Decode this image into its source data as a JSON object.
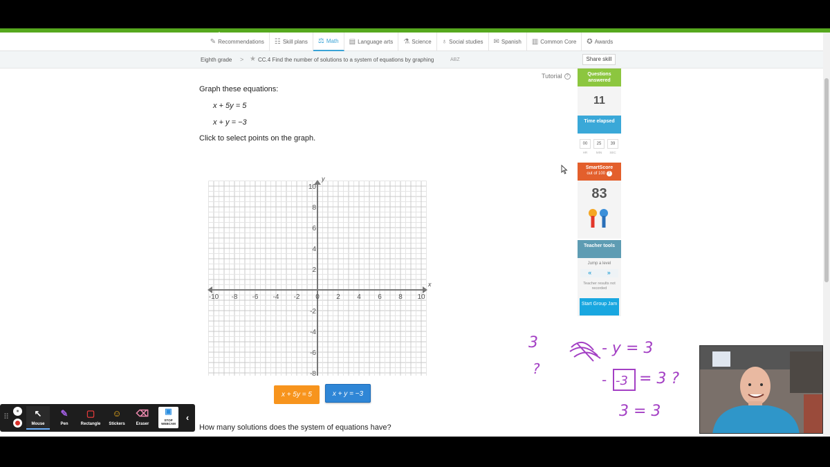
{
  "nav": {
    "items": [
      {
        "icon": "recommendations-icon",
        "glyph": "✎",
        "label": "Recommendations"
      },
      {
        "icon": "skill-plans-icon",
        "glyph": "☷",
        "label": "Skill plans"
      },
      {
        "icon": "math-icon",
        "glyph": "⚖",
        "label": "Math",
        "active": true
      },
      {
        "icon": "language-arts-icon",
        "glyph": "▤",
        "label": "Language arts"
      },
      {
        "icon": "science-icon",
        "glyph": "⚗",
        "label": "Science"
      },
      {
        "icon": "social-studies-icon",
        "glyph": "♁",
        "label": "Social studies"
      },
      {
        "icon": "spanish-icon",
        "glyph": "✉",
        "label": "Spanish"
      },
      {
        "icon": "common-core-icon",
        "glyph": "▥",
        "label": "Common Core"
      },
      {
        "icon": "awards-icon",
        "glyph": "✪",
        "label": "Awards"
      }
    ],
    "accent": "#3aa3d6"
  },
  "breadcrumb": {
    "grade": "Eighth grade",
    "separator": ">",
    "skill": "CC.4 Find the number of solutions to a system of equations by graphing",
    "code": "ABZ",
    "share_label": "Share skill"
  },
  "tutorial": {
    "label": "Tutorial",
    "icon_glyph": "?"
  },
  "problem": {
    "prompt": "Graph these equations:",
    "equations": [
      "x + 5y = 5",
      "x + y = −3"
    ],
    "instruction": "Click to select points on the graph.",
    "question": "How many solutions does the system of equations have?"
  },
  "graph": {
    "x_label": "x",
    "y_label": "y",
    "x_min": -10,
    "x_max": 10,
    "y_min": -10,
    "y_max": 10,
    "x_ticks": [
      "-10",
      "-8",
      "-6",
      "-4",
      "-2",
      "0",
      "2",
      "4",
      "6",
      "8",
      "10"
    ],
    "y_ticks": [
      "10",
      "8",
      "6",
      "4",
      "2",
      "-2",
      "-4",
      "-6",
      "-8",
      "-10"
    ],
    "grid": true
  },
  "equation_buttons": [
    {
      "label": "x + 5y = 5",
      "color": "#f7941d"
    },
    {
      "label": "x + y = −3",
      "color": "#2f86d6",
      "selected": true
    }
  ],
  "sidebar": {
    "questions_answered_label": "Questions answered",
    "questions_answered": "11",
    "time_elapsed_label": "Time elapsed",
    "time": {
      "hr": "00",
      "min": "25",
      "sec": "39"
    },
    "time_units": {
      "hr": "HR",
      "min": "MIN",
      "sec": "SEC"
    },
    "smartscore_label": "SmartScore",
    "smartscore_sub": "out of 100",
    "smartscore_help": "?",
    "smartscore": "83",
    "teacher_tools_label": "Teacher tools",
    "jump_label": "Jump a level",
    "jump_back": "«",
    "jump_forward": "»",
    "results_note": "Teacher results not recorded",
    "group_jam_label": "Start Group Jam",
    "colors": {
      "questions": "#8cc63f",
      "time": "#3aa8d8",
      "smartscore": "#e35f2c",
      "teacher": "#5e9cb3"
    }
  },
  "annotations": {
    "left_3": "3",
    "left_q": "?",
    "eq_end": "- y = 3",
    "boxed": "-3",
    "line2_end": "= 3 ?",
    "line3": "3 = 3",
    "ink_color": "#a33fc4"
  },
  "recorder": {
    "pause_glyph": "⏸",
    "tools": [
      {
        "name": "mouse",
        "label": "Mouse",
        "glyph": "↖"
      },
      {
        "name": "pen",
        "label": "Pen",
        "glyph": "✎"
      },
      {
        "name": "rectangle",
        "label": "Rectangle",
        "glyph": "▢"
      },
      {
        "name": "stickers",
        "label": "Stickers",
        "glyph": "☺"
      },
      {
        "name": "eraser",
        "label": "Eraser",
        "glyph": "⌫"
      }
    ],
    "stop_label": "STOP WEBCAM",
    "collapse_glyph": "‹",
    "grip_glyph": "⠿"
  }
}
